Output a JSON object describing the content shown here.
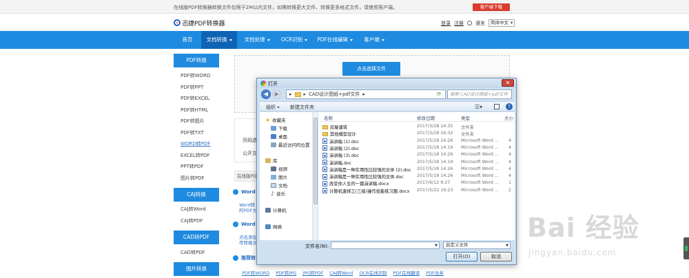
{
  "topbar": {
    "notice": "在线版PDF转换器转换文件仅限于2M以内文件，如需转换更大文件、转换更多格式文件，请使用客户端。",
    "client_download": "客户端下载"
  },
  "header": {
    "logo_text": "迅捷PDF转换器",
    "login": "登录",
    "register": "注册",
    "language_label": "语言",
    "language_value": "简体中文"
  },
  "nav": {
    "items": [
      {
        "label": "首页",
        "has_caret": false
      },
      {
        "label": "文档转换",
        "has_caret": true,
        "active": true
      },
      {
        "label": "文档处理",
        "has_caret": true
      },
      {
        "label": "OCR识别",
        "has_caret": true
      },
      {
        "label": "PDF在线编辑",
        "has_caret": true
      },
      {
        "label": "客户端",
        "has_caret": true
      }
    ]
  },
  "sidebar": {
    "groups": [
      {
        "title": "PDF转换",
        "items": [
          "PDF转WORD",
          "PDF转PPT",
          "PDF转EXCEL",
          "PDF转HTML",
          "PDF转图片",
          "PDF转TXT",
          "WORD转PDF",
          "EXCEL转PDF",
          "PPT转PDF",
          "图片转PDF"
        ],
        "selected": "WORD转PDF"
      },
      {
        "title": "CAJ转换",
        "items": [
          "CAJ转Word",
          "CAJ转PDF"
        ]
      },
      {
        "title": "CAD转PDF",
        "items": [
          "CAD转PDF"
        ]
      },
      {
        "title": "图片转换",
        "items": []
      }
    ]
  },
  "main": {
    "upload_button": "点击选择文件",
    "page_label": "页码选",
    "public_label": "公开文",
    "tip_strip": "在线版PD",
    "section1_title": "Word",
    "section1_desc1": "Word转",
    "section1_desc2": "的PDF文",
    "section2_title": "Word",
    "section2_desc1": "点击添加",
    "section2_desc2": "传转换文",
    "section3_title": "推荐转",
    "bottom_links": [
      "PDF转WORD",
      "PDF转JPG",
      "JPG转PDF",
      "CAJ转Word",
      "OCR在线识别",
      "PDF在线翻译",
      "PDF合并"
    ]
  },
  "watermark": {
    "text": "Bai 经验",
    "sub": "jingyan.baidu.com"
  },
  "dialog": {
    "title": "打开",
    "breadcrumb": [
      "CAD设计图纸+pdf文件"
    ],
    "search_placeholder": "搜索 CAD设计图纸+pdf文件",
    "toolbar": {
      "organize": "组织",
      "new_folder": "新建文件夹"
    },
    "nav_pane": {
      "favorites": "收藏夹",
      "downloads": "下载",
      "desktop": "桌面",
      "recent": "最近访问的位置",
      "libraries": "库",
      "videos": "视频",
      "pictures": "图片",
      "documents": "文档",
      "music": "音乐",
      "computer": "计算机",
      "network": "网络"
    },
    "columns": {
      "name": "名称",
      "date": "修改日期",
      "type": "类型",
      "size": "大小"
    },
    "files": [
      {
        "name": "房屋建筑",
        "date": "2017/3/28 14:35",
        "type": "文件夹",
        "size": "",
        "kind": "folder"
      },
      {
        "name": "其他模型设计",
        "date": "2017/3/28 16:32",
        "type": "文件夹",
        "size": "",
        "kind": "folder"
      },
      {
        "name": "演讲稿 (1).doc",
        "date": "2017/5/18 14:26",
        "type": "Microsoft Word ...",
        "size": "4",
        "kind": "doc"
      },
      {
        "name": "演讲稿 (2).doc",
        "date": "2017/5/18 14:19",
        "type": "Microsoft Word ...",
        "size": "4",
        "kind": "doc"
      },
      {
        "name": "演讲稿 (3).doc",
        "date": "2017/5/18 14:26",
        "type": "Microsoft Word ...",
        "size": "4",
        "kind": "doc"
      },
      {
        "name": "演讲稿.doc",
        "date": "2017/5/18 14:19",
        "type": "Microsoft Word ...",
        "size": "4",
        "kind": "doc"
      },
      {
        "name": "演讲稿是一种实用性比较强的文体 (2).doc",
        "date": "2017/5/18 14:26",
        "type": "Microsoft Word ...",
        "size": "4",
        "kind": "doc"
      },
      {
        "name": "演讲稿是一种实用性比较强的文体.doc",
        "date": "2017/5/18 14:26",
        "type": "Microsoft Word ...",
        "size": "4",
        "kind": "doc"
      },
      {
        "name": "改变你人生的一篇演讲稿.docx",
        "date": "2017/6/12 9:27",
        "type": "Microsoft Word ...",
        "size": "1",
        "kind": "doc"
      },
      {
        "name": "计算机速择工(三级)操作技能练习题.docx",
        "date": "2017/5/22 19:23",
        "type": "Microsoft Word ...",
        "size": "2",
        "kind": "doc"
      }
    ],
    "filename_label": "文件名(N):",
    "filename_value": "",
    "filetype": "自定义文件",
    "open_button": "打开(O)",
    "cancel_button": "取消"
  }
}
